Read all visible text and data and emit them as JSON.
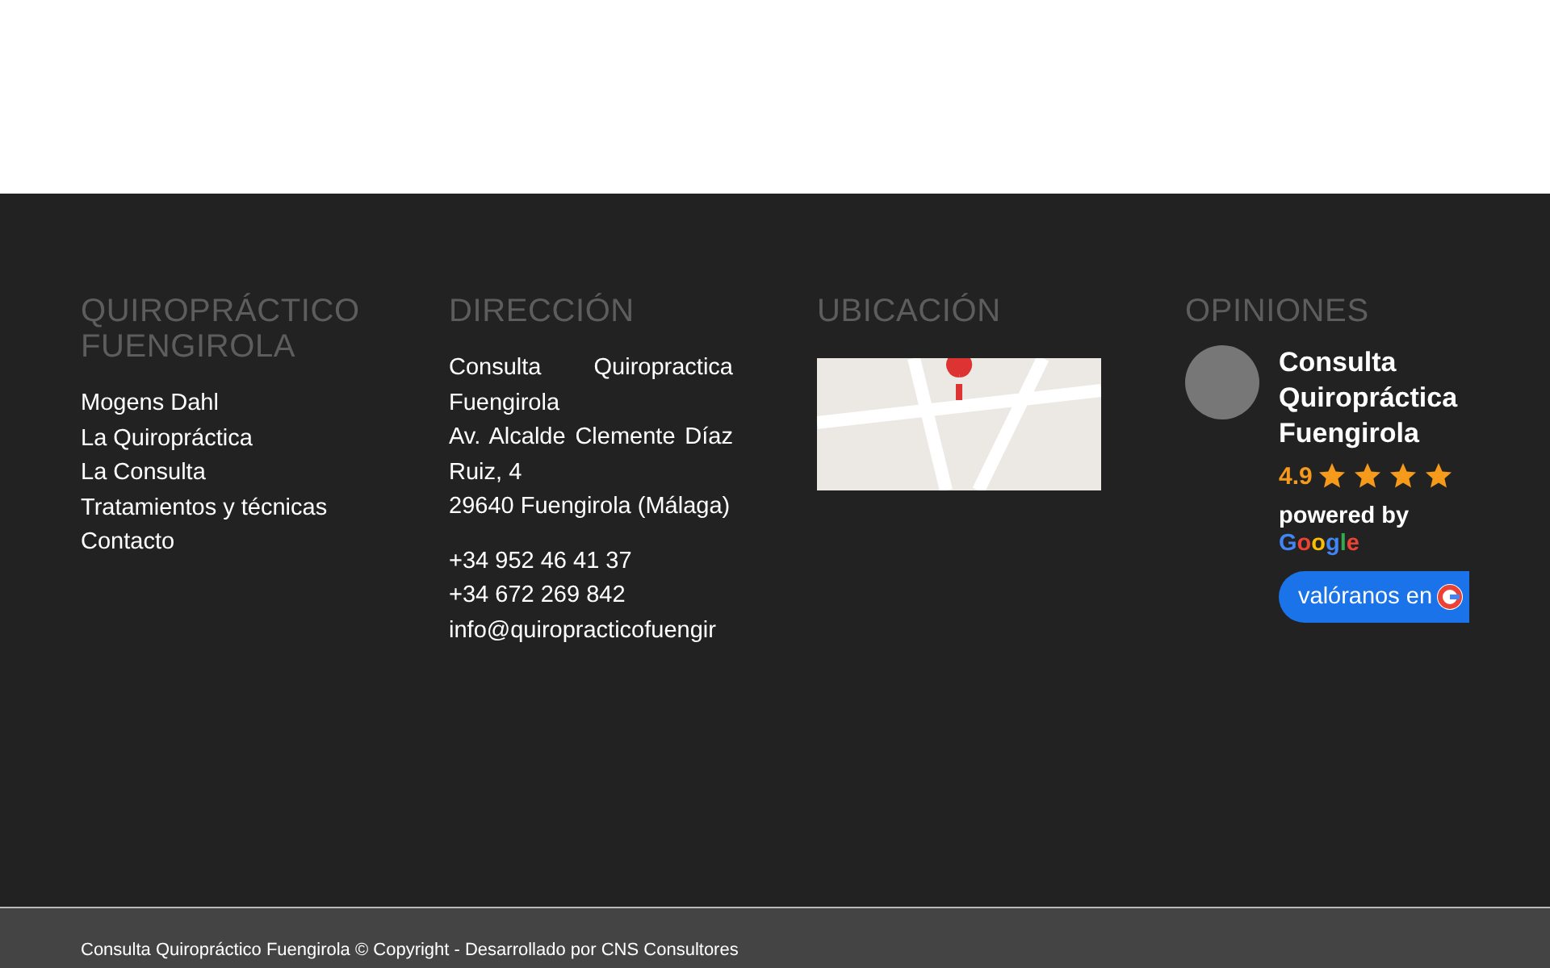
{
  "footer": {
    "columns": [
      {
        "kind": "links",
        "title": "QUIROPRÁCTICO FUENGIROLA",
        "links": [
          "Mogens Dahl",
          "La Quiropráctica",
          "La Consulta",
          "Tratamientos y técnicas",
          "Contacto"
        ]
      },
      {
        "kind": "address",
        "title": "DIRECCIÓN",
        "address": [
          "Consulta Quiropractica Fuengirola",
          "Av. Alcalde Clemente Díaz Ruiz, 4",
          "29640 Fuengirola (Málaga)"
        ],
        "contacts": [
          "+34 952 46 41 37",
          "+34 672 269 842",
          "info@quiropracticofuengir"
        ]
      },
      {
        "kind": "map",
        "title": "UBICACIÓN"
      },
      {
        "kind": "reviews",
        "title": "OPINIONES",
        "business": "Consulta Quiropráctica Fuengirola",
        "rating": "4.9",
        "stars": 4,
        "powered_by": "powered by",
        "google": "Google",
        "button": "valóranos en"
      }
    ]
  },
  "bottom_bar": {
    "text": "Consulta Quiropráctico Fuengirola © Copyright - Desarrollado por CNS Consultores"
  }
}
